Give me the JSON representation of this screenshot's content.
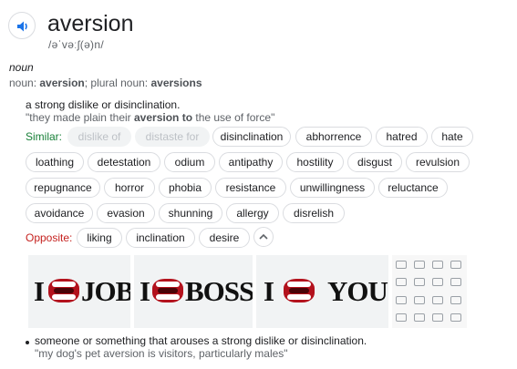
{
  "entry": {
    "word": "aversion",
    "phonetic": "/əˈvəːʃ(ə)n/",
    "part_of_speech": "noun",
    "forms": {
      "noun_label": "noun:",
      "noun": "aversion",
      "separator": ";",
      "plural_label": "plural noun:",
      "plural": "aversions"
    }
  },
  "sense1": {
    "definition": "a strong dislike or disinclination.",
    "example_before": "\"they made plain their ",
    "example_bold": "aversion to",
    "example_after": " the use of force\"",
    "similar_label": "Similar:",
    "similar": [
      "dislike of",
      "distaste for",
      "disinclination",
      "abhorrence",
      "hatred",
      "hate",
      "loathing",
      "detestation",
      "odium",
      "antipathy",
      "hostility",
      "disgust",
      "revulsion",
      "repugnance",
      "horror",
      "phobia",
      "resistance",
      "unwillingness",
      "reluctance",
      "avoidance",
      "evasion",
      "shunning",
      "allergy",
      "disrelish"
    ],
    "opposite_label": "Opposite:",
    "opposite": [
      "liking",
      "inclination",
      "desire"
    ]
  },
  "images": {
    "image1": {
      "letter": "I",
      "word": "JOB"
    },
    "image2": {
      "letter": "I",
      "word": "BOSS"
    },
    "image3": {
      "letter": "I",
      "word": "YOU"
    }
  },
  "sense2": {
    "definition": "someone or something that arouses a strong dislike or disinclination.",
    "example": "\"my dog's pet aversion is visitors, particularly males\""
  },
  "colors": {
    "similar_label": "#188038",
    "opposite_label": "#c5221f",
    "speaker_icon": "#1a73e8"
  },
  "icons": {
    "speaker": "speaker-icon",
    "expand": "chevron-up-icon"
  }
}
